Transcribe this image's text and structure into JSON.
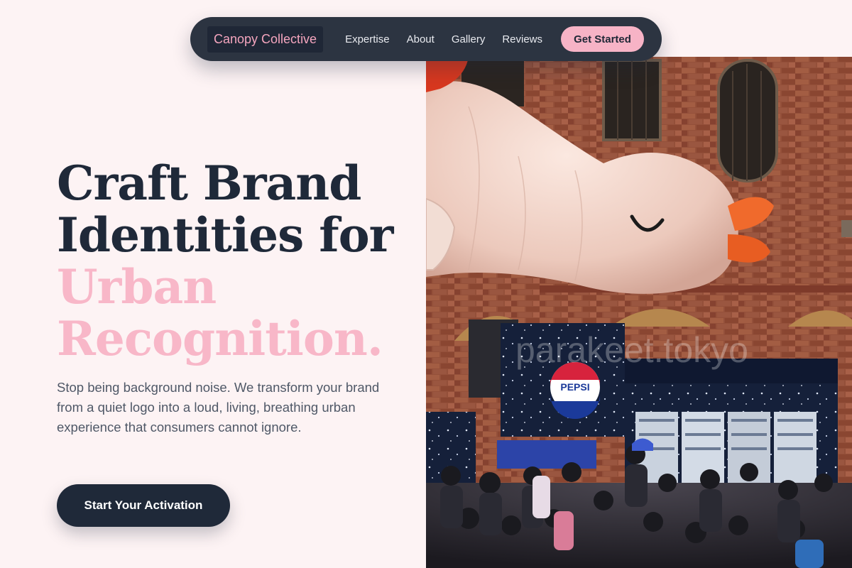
{
  "nav": {
    "brand": "Canopy Collective",
    "links": [
      {
        "label": "Expertise"
      },
      {
        "label": "About"
      },
      {
        "label": "Gallery"
      },
      {
        "label": "Reviews"
      }
    ],
    "cta_label": "Get Started"
  },
  "hero": {
    "headline_line1": "Craft Brand",
    "headline_line2": "Identities for",
    "headline_accent1": "Urban",
    "headline_accent2": "Recognition.",
    "lede": "Stop being background noise. We transform your brand from a quiet logo into a loud, living, breathing urban experience that consumers cannot ignore.",
    "cta_label": "Start Your Activation"
  },
  "photo": {
    "watermark": "parakeet.tokyo",
    "logo_text": "PEPSI"
  },
  "colors": {
    "page_bg": "#fdf3f4",
    "nav_bg": "#2c3441",
    "accent_pink": "#f7b3c6",
    "dark_navy": "#1f2939",
    "body_text": "#4f5867"
  }
}
